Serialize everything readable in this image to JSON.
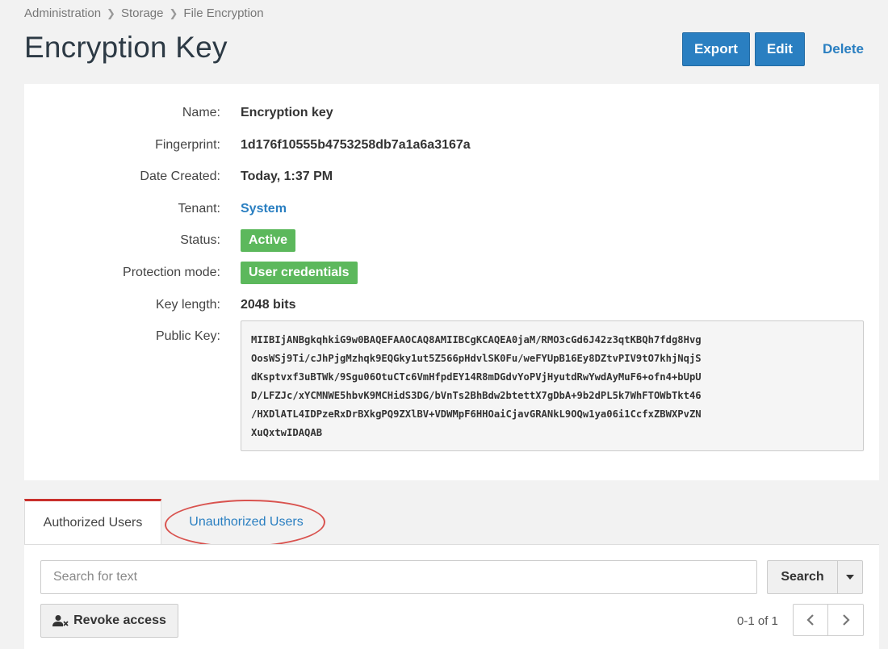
{
  "breadcrumb": [
    "Administration",
    "Storage",
    "File Encryption"
  ],
  "page_title": "Encryption Key",
  "actions": {
    "export": "Export",
    "edit": "Edit",
    "delete": "Delete"
  },
  "details": {
    "name": {
      "label": "Name:",
      "value": "Encryption key"
    },
    "fingerprint": {
      "label": "Fingerprint:",
      "value": "1d176f10555b4753258db7a1a6a3167a"
    },
    "date_created": {
      "label": "Date Created:",
      "value": "Today, 1:37 PM"
    },
    "tenant": {
      "label": "Tenant:",
      "value": "System"
    },
    "status": {
      "label": "Status:",
      "value": "Active"
    },
    "protection_mode": {
      "label": "Protection mode:",
      "value": "User credentials"
    },
    "key_length": {
      "label": "Key length:",
      "value": "2048 bits"
    },
    "public_key": {
      "label": "Public Key:",
      "value": "MIIBIjANBgkqhkiG9w0BAQEFAAOCAQ8AMIIBCgKCAQEA0jaM/RMO3cGd6J42z3qtKBQh7fdg8Hvg\nOosWSj9Ti/cJhPjgMzhqk9EQGky1ut5Z566pHdvlSK0Fu/weFYUpB16Ey8DZtvPIV9tO7khjNqjS\ndKsptvxf3uBTWk/9Sgu06OtuCTc6VmHfpdEY14R8mDGdvYoPVjHyutdRwYwdAyMuF6+ofn4+bUpU\nD/LFZJc/xYCMNWE5hbvK9MCHidS3DG/bVnTs2BhBdw2btettX7gDbA+9b2dPL5k7WhFTOWbTkt46\n/HXDlATL4IDPzeRxDrBXkgPQ9ZXlBV+VDWMpF6HHOaiCjavGRANkL9OQw1ya06i1CcfxZBWXPvZN\nXuQxtwIDAQAB"
    }
  },
  "tabs": {
    "authorized": "Authorized Users",
    "unauthorized": "Unauthorized Users"
  },
  "search": {
    "placeholder": "Search for text",
    "button": "Search"
  },
  "revoke_button": "Revoke access",
  "pagination": {
    "count": "0-1 of 1"
  },
  "colors": {
    "primary": "#2a7fc1",
    "success": "#5cb85c",
    "highlight": "#d9534f"
  }
}
